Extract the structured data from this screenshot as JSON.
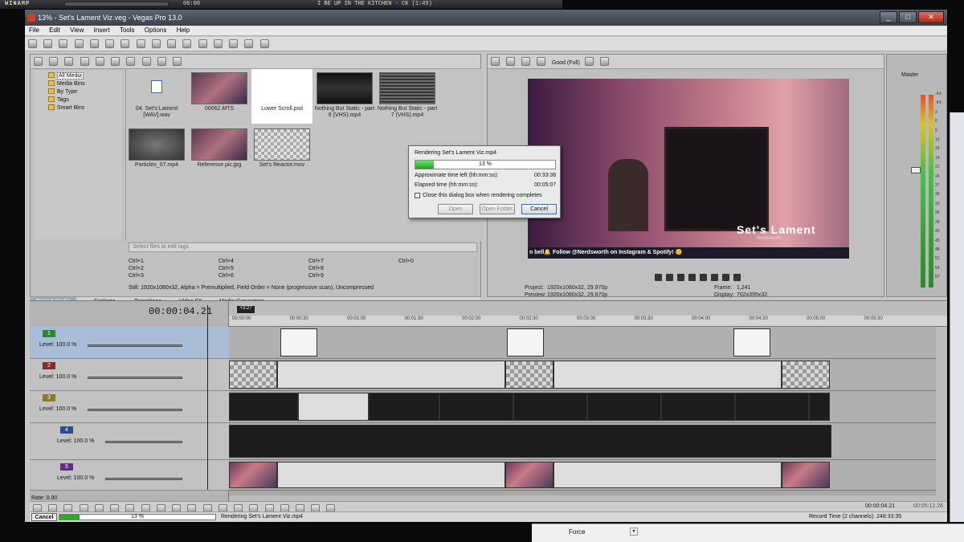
{
  "winamp": {
    "label": "WINAMP",
    "song": "I BE UP IN THE KITCHEN - CK (1:49)",
    "time": "00:00"
  },
  "window": {
    "title": "13% - Set's Lament Viz.veg - Vegas Pro 13.0"
  },
  "menu": [
    "File",
    "Edit",
    "View",
    "Insert",
    "Tools",
    "Options",
    "Help"
  ],
  "media": {
    "tree": [
      "All Media",
      "Media Bins",
      "By Type",
      "Tags",
      "Smart Bins"
    ],
    "files": [
      {
        "name": "04. Set's Lament [WAV].wav"
      },
      {
        "name": "00062.MTS"
      },
      {
        "name": "Lower Scroll.psd"
      },
      {
        "name": "Nothing But Static - part 6 (VHS).mp4"
      },
      {
        "name": "Nothing But Static - part 7 (VHS).mp4"
      },
      {
        "name": "Particles_07.mp4"
      },
      {
        "name": "Reference pic.jpg"
      },
      {
        "name": "Set's Reactor.mov"
      }
    ],
    "tag_placeholder": "Select files to edit tags",
    "shortcuts": [
      "Ctrl+1",
      "Ctrl+2",
      "Ctrl+3",
      "Ctrl+4",
      "Ctrl+5",
      "Ctrl+6",
      "Ctrl+7",
      "Ctrl+8",
      "Ctrl+9",
      "Ctrl+0"
    ],
    "info": "Still: 1920x1080x32, Alpha = Premultiplied, Field Order = None (progressive scan), Uncompressed",
    "tabs": [
      "Project Media",
      "Explorer",
      "Transitions",
      "Video FX",
      "Media Generators"
    ]
  },
  "preview": {
    "quality": "Good (Full)",
    "overlay_title": "Set's Lament",
    "overlay_sub": "Nerdsworth",
    "ticker": "n bell🔔 Follow @Nerdsworth on Instagram & Spotify! 😊",
    "project_label": "Project:",
    "project": "1920x1080x32, 29.970p",
    "preview_label": "Preview:",
    "preview_val": "1920x1080x32, 29.970p",
    "frame_label": "Frame:",
    "frame": "1,241",
    "display_label": "Display:",
    "display": "702x395x32"
  },
  "master": {
    "label": "Master",
    "db": [
      "-Inf.",
      "-Inf.",
      "3",
      "6",
      "9",
      "12",
      "15",
      "18",
      "21",
      "24",
      "27",
      "30",
      "33",
      "36",
      "39",
      "42",
      "45",
      "48",
      "51",
      "54",
      "57"
    ]
  },
  "render": {
    "title": "Rendering Set's Lament Viz.mp4",
    "percent": "13 %",
    "progress": 0.13,
    "time_left_label": "Approximate time left (hh:mm:ss):",
    "time_left": "00:33:36",
    "elapsed_label": "Elapsed time (hh:mm:ss):",
    "elapsed": "00:05:07",
    "close_label": "Close this dialog box when rendering completes",
    "open": "Open",
    "open_folder": "Open Folder",
    "cancel": "Cancel"
  },
  "timeline": {
    "timecode": "00:00:04.21",
    "marker": "+3:27",
    "ruler": [
      "00:00:00",
      "00:00:30",
      "00:01:00",
      "00:01:30",
      "00:02:00",
      "00:02:30",
      "00:03:00",
      "00:03:30",
      "00:04:00",
      "00:04:30",
      "00:05:00",
      "00:05:30"
    ],
    "tracks": [
      {
        "num": "1",
        "level": "Level: 100.0 %",
        "color": "#2a8a2a"
      },
      {
        "num": "2",
        "level": "Level: 100.0 %",
        "color": "#8a2a2a"
      },
      {
        "num": "3",
        "level": "Level: 100.0 %",
        "color": "#8a7a20"
      },
      {
        "num": "4",
        "level": "Level: 100.0 %",
        "color": "#2a4a9a"
      },
      {
        "num": "5",
        "level": "Level: 100.0 %",
        "color": "#6a2a8a"
      }
    ],
    "rate": "Rate: 0.00"
  },
  "bottom": {
    "timecode": "00:00:04.21",
    "end_time": "00:05:12.26",
    "cancel": "Cancel",
    "percent": "13 %",
    "status": "Rendering Set's Lament Viz.mp4",
    "record_time": "Record Time (2 channels): 248:33:35"
  },
  "behind": {
    "force": "Force"
  }
}
